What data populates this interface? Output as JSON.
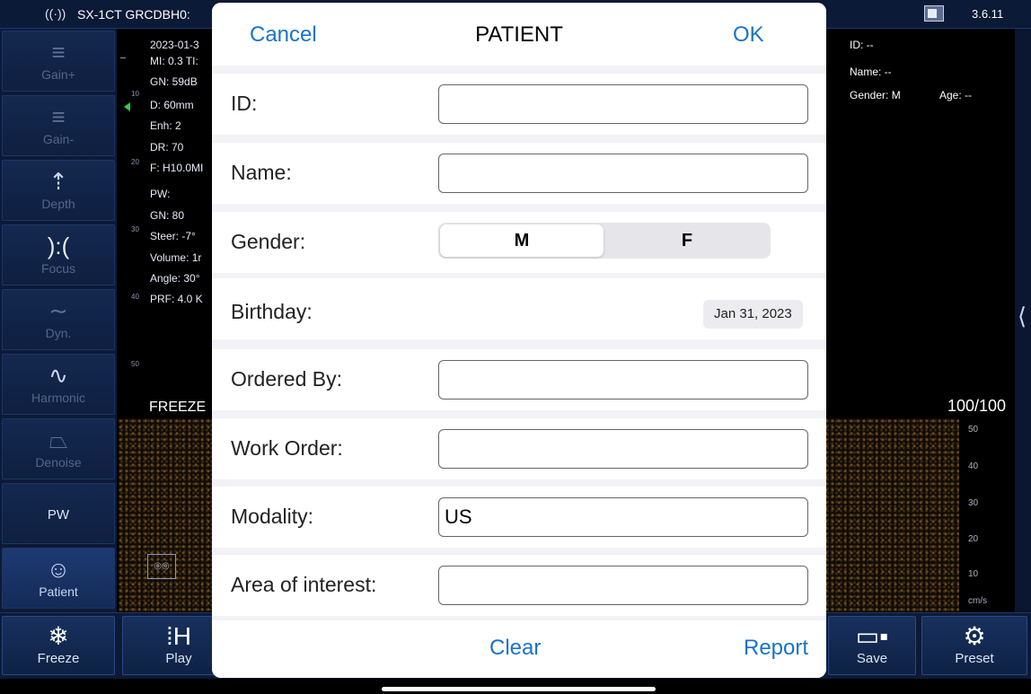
{
  "status_bar": {
    "device_name": "SX-1CT GRCDBH0:",
    "version": "3.6.11"
  },
  "sidebar": {
    "items": [
      {
        "label": "Gain+",
        "icon": "gain-up-icon"
      },
      {
        "label": "Gain-",
        "icon": "gain-down-icon"
      },
      {
        "label": "Depth",
        "icon": "depth-icon"
      },
      {
        "label": "Focus",
        "icon": "focus-icon"
      },
      {
        "label": "Dyn.",
        "icon": "dynamic-range-icon"
      },
      {
        "label": "Harmonic",
        "icon": "harmonic-wave-icon"
      },
      {
        "label": "Denoise",
        "icon": "denoise-icon"
      },
      {
        "label": "PW",
        "icon": ""
      },
      {
        "label": "Patient",
        "icon": "patient-icon"
      }
    ]
  },
  "scan_info": {
    "lines": [
      "2023-01-3",
      "MI: 0.3  TI:",
      "GN: 59dB",
      "D: 60mm",
      "Enh: 2",
      "DR: 70",
      "F: H10.0MI",
      "PW:",
      "GN: 80",
      "Steer: -7°",
      "Volume: 1r",
      "Angle: 30°",
      "PRF: 4.0 K"
    ],
    "depth_ticks": [
      "10",
      "20",
      "30",
      "40",
      "50"
    ],
    "freeze_label": "FREEZE",
    "right_id": "ID: --",
    "right_name": "Name: --",
    "right_gender": "Gender: M",
    "right_age": "Age: --",
    "pw_ratio": "100/100",
    "velocity_scale": [
      "50",
      "40",
      "30",
      "20",
      "10"
    ],
    "velocity_unit": "cm/s"
  },
  "bottom_bar": {
    "freeze": "Freeze",
    "play": "Play",
    "save": "Save",
    "preset": "Preset"
  },
  "modal": {
    "cancel": "Cancel",
    "title": "PATIENT",
    "ok": "OK",
    "fields": {
      "id_label": "ID:",
      "id_value": "",
      "name_label": "Name:",
      "name_value": "",
      "gender_label": "Gender:",
      "gender_options": [
        "M",
        "F"
      ],
      "gender_selected": "M",
      "birthday_label": "Birthday:",
      "birthday_value": "Jan 31, 2023",
      "ordered_by_label": "Ordered By:",
      "ordered_by_value": "",
      "work_order_label": "Work Order:",
      "work_order_value": "",
      "modality_label": "Modality:",
      "modality_value": "US",
      "area_label": "Area of interest:",
      "area_value": ""
    },
    "clear": "Clear",
    "report": "Report"
  },
  "colors": {
    "accent_blue": "#1a73c9",
    "panel_dark": "#0d1a36"
  }
}
